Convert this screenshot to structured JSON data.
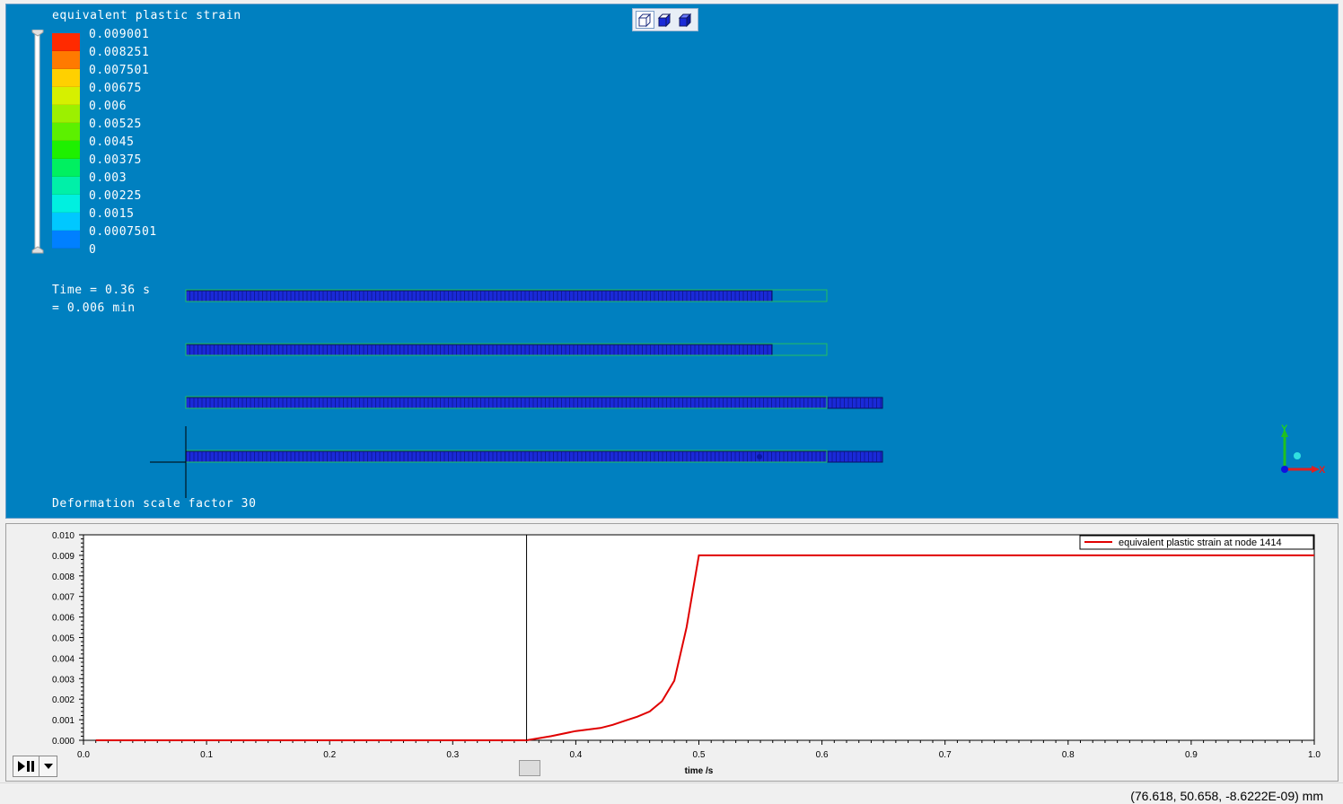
{
  "viewport": {
    "legend": {
      "title": "equivalent plastic strain",
      "entries": [
        {
          "label": "0.009001",
          "color": "#ff2a00"
        },
        {
          "label": "0.008251",
          "color": "#ff7a00"
        },
        {
          "label": "0.007501",
          "color": "#ffd000"
        },
        {
          "label": "0.00675",
          "color": "#d6f000"
        },
        {
          "label": "0.006",
          "color": "#9cf000"
        },
        {
          "label": "0.00525",
          "color": "#5cf000"
        },
        {
          "label": "0.0045",
          "color": "#1ef000"
        },
        {
          "label": "0.00375",
          "color": "#00f060"
        },
        {
          "label": "0.003",
          "color": "#00f0a8"
        },
        {
          "label": "0.00225",
          "color": "#00f0e0"
        },
        {
          "label": "0.0015",
          "color": "#00c8ff"
        },
        {
          "label": "0.0007501",
          "color": "#0080ff"
        },
        {
          "label": "0",
          "color": "#0030ff"
        }
      ]
    },
    "time_line1": "Time = 0.36 s",
    "time_line2": "= 0.006 min",
    "deformation_text": "Deformation scale factor 30",
    "background_color": "#0080c0",
    "mesh_color": "#1a2ad8",
    "outline_color": "#22c060",
    "axes": {
      "x": "X",
      "y": "Y"
    },
    "view_buttons": [
      "view-iso-outline-icon",
      "view-iso-shaded-icon",
      "view-iso-solid-icon"
    ]
  },
  "plot": {
    "legend_label": "equivalent plastic strain at node 1414",
    "cursor_time": 0.36
  },
  "chart_data": {
    "type": "line",
    "title": "",
    "xlabel": "time /s",
    "ylabel": "",
    "xlim": [
      0.0,
      1.0
    ],
    "ylim": [
      0.0,
      0.01
    ],
    "x_ticks": [
      "0.0",
      "0.1",
      "0.2",
      "0.3",
      "0.4",
      "0.5",
      "0.6",
      "0.7",
      "0.8",
      "0.9",
      "1.0"
    ],
    "y_ticks": [
      "0.000",
      "0.001",
      "0.002",
      "0.003",
      "0.004",
      "0.005",
      "0.006",
      "0.007",
      "0.008",
      "0.009",
      "0.010"
    ],
    "legend_position": "top-right",
    "series": [
      {
        "name": "equivalent plastic strain at node 1414",
        "color": "#e00000",
        "x": [
          0.01,
          0.36,
          0.38,
          0.4,
          0.42,
          0.43,
          0.44,
          0.45,
          0.46,
          0.47,
          0.48,
          0.49,
          0.5,
          1.0
        ],
        "y": [
          0.0,
          0.0,
          0.0002,
          0.00045,
          0.0006,
          0.00075,
          0.00095,
          0.00115,
          0.0014,
          0.0019,
          0.0029,
          0.0055,
          0.009,
          0.009
        ]
      }
    ]
  },
  "status": {
    "coordinates": "(76.618, 50.658, -8.6222E-09) mm"
  }
}
